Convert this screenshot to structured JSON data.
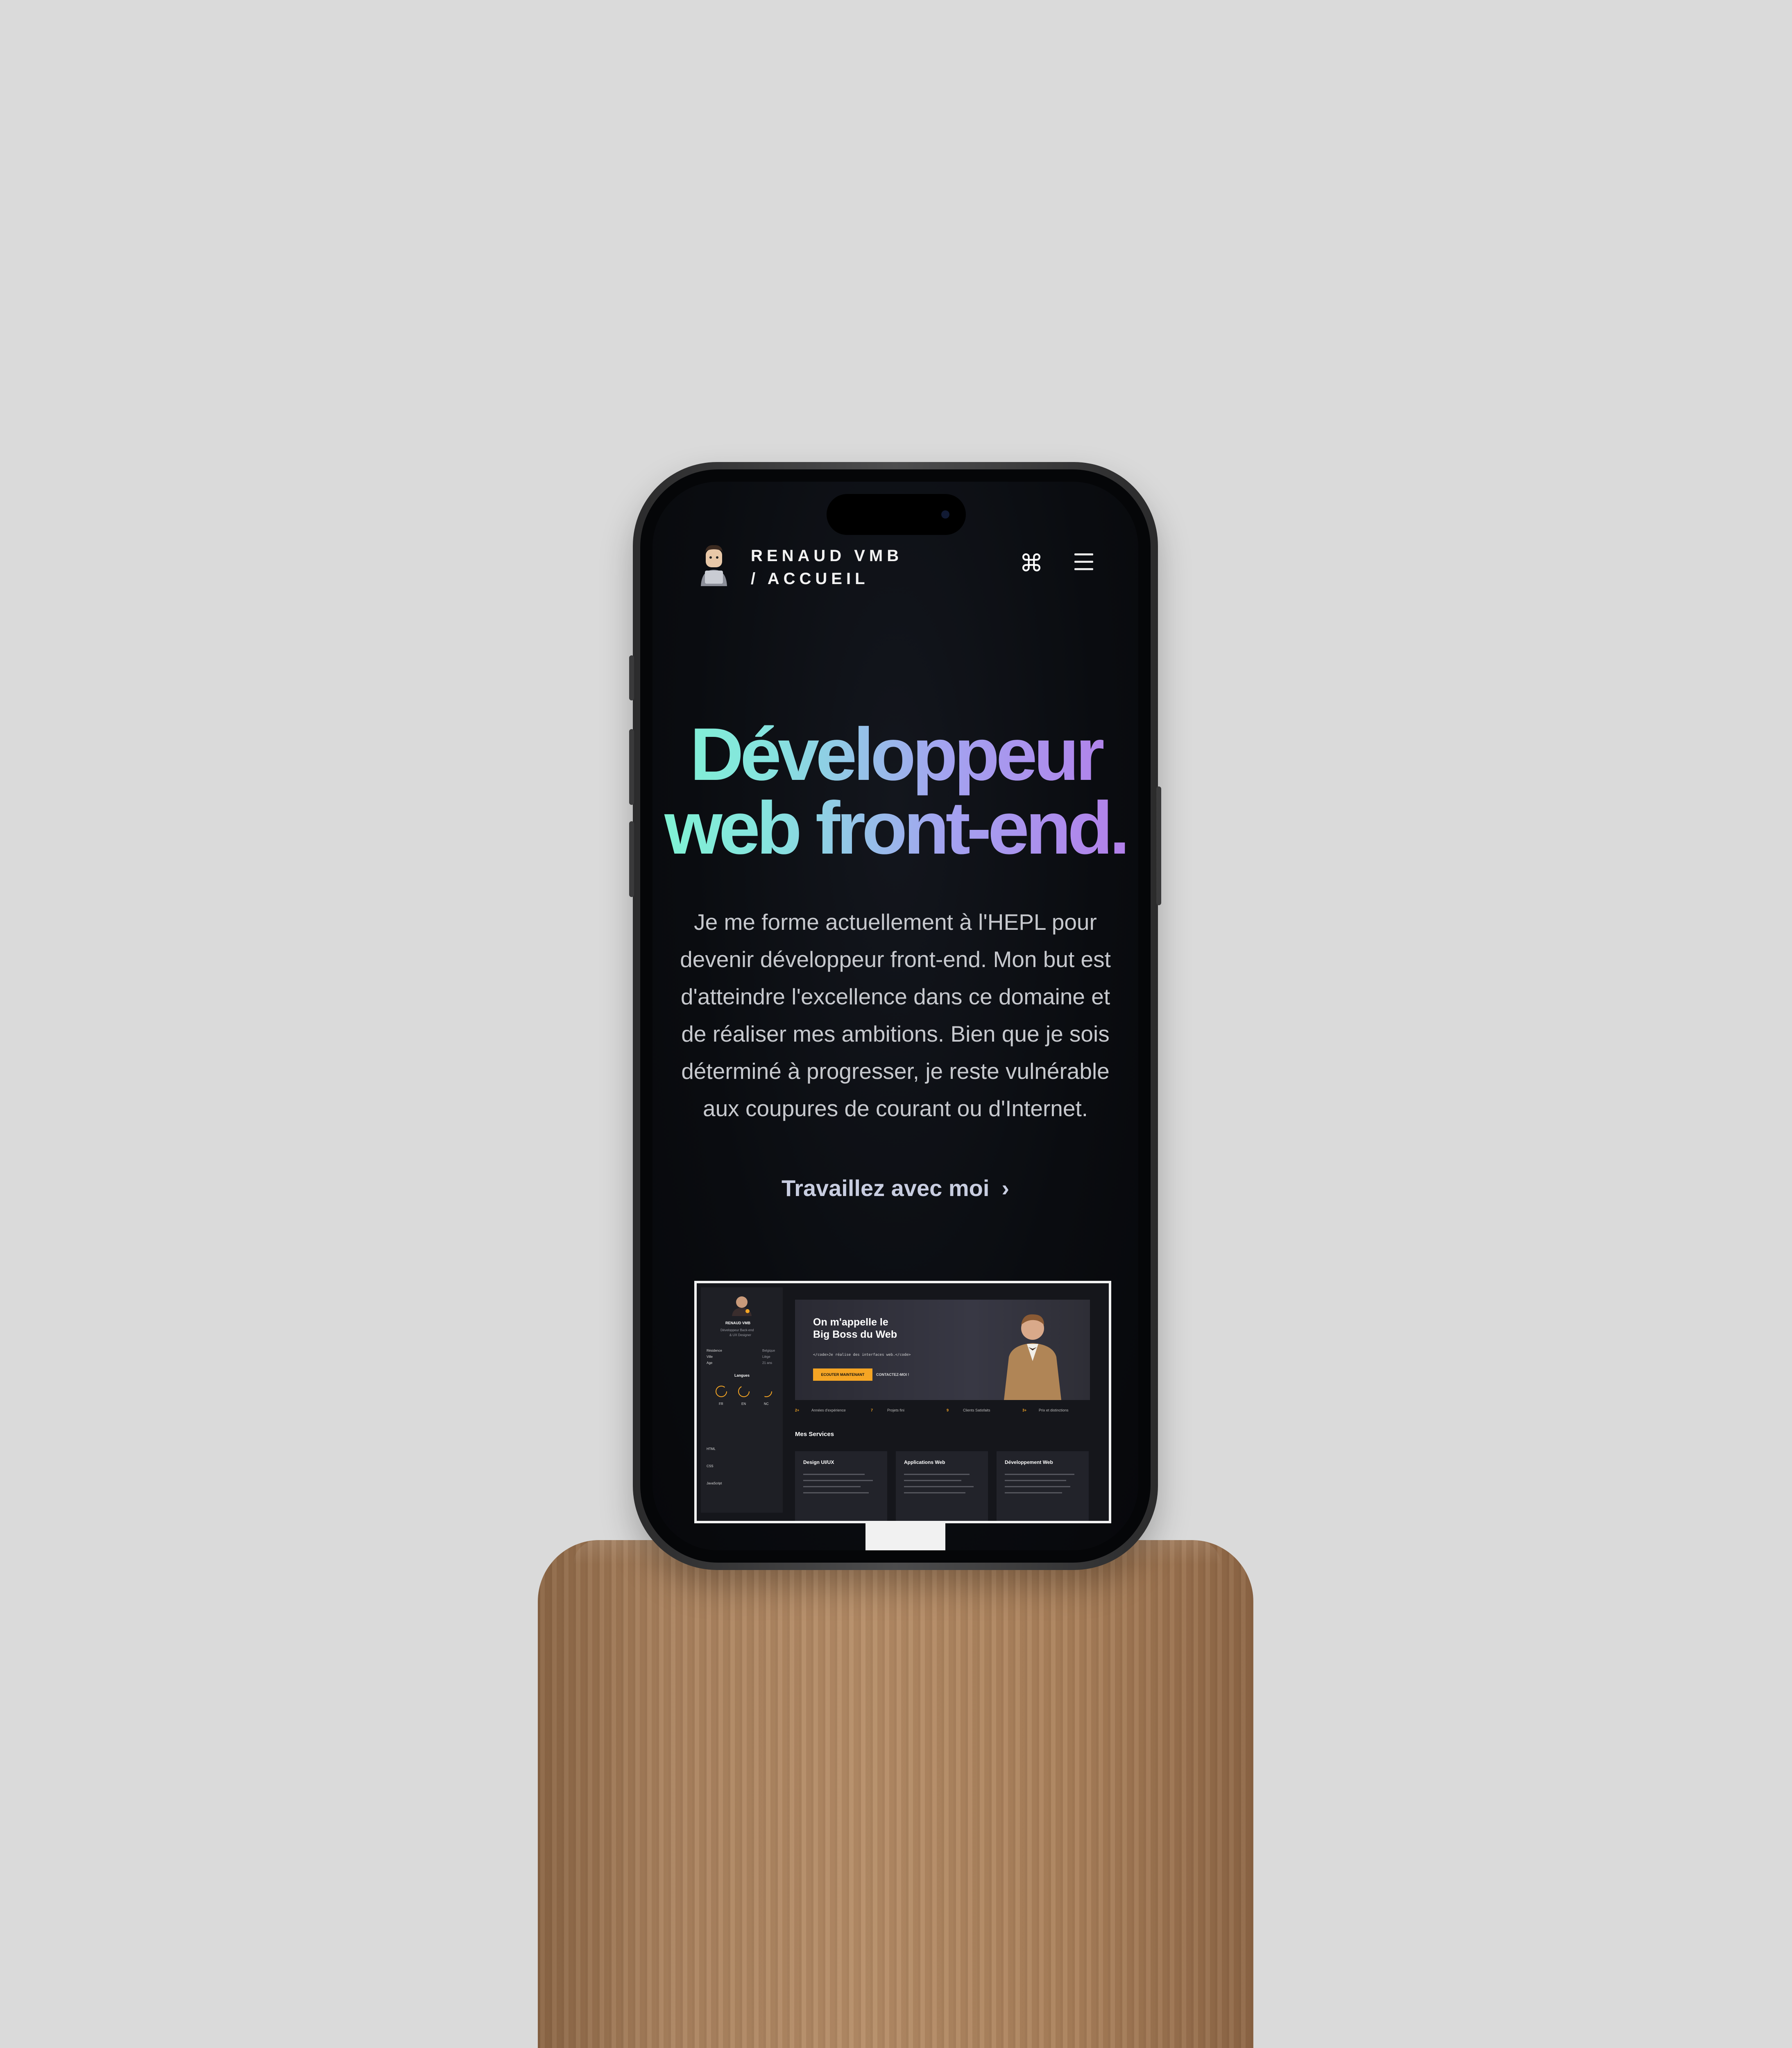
{
  "header": {
    "name_line1": "RENAUD VMB",
    "name_line2": "/ ACCUEIL",
    "command_icon": "⌘",
    "menu_icon": "hamburger-menu"
  },
  "hero": {
    "headline_line1": "Développeur",
    "headline_line2": "web front-end.",
    "gradient_colors": [
      "#7ff4d3",
      "#a3a3f0",
      "#b37de9"
    ],
    "intro_lines": [
      "Je me forme actuellement à l'HEPL pour",
      "devenir développeur front-end. Mon but est",
      "d'atteindre l'excellence dans ce domaine et",
      "de réaliser mes ambitions. Bien que je sois",
      "déterminé à progresser, je reste vulnérable",
      "aux coupures de courant ou d'Internet."
    ],
    "cta_label": "Travaillez avec moi",
    "cta_icon": "chevron-right"
  },
  "preview": {
    "sidebar": {
      "name": "RENAUD VMB",
      "role_line1": "Développeur Back-end",
      "role_line2": "& UX Designer",
      "info": [
        {
          "label": "Résidence",
          "value": "Belgique"
        },
        {
          "label": "Ville",
          "value": "Liège"
        },
        {
          "label": "Age",
          "value": "21 ans"
        }
      ],
      "languages_title": "Langues",
      "languages": [
        "FR",
        "EN",
        "NC"
      ],
      "skills": [
        "HTML",
        "CSS",
        "JavaScript"
      ]
    },
    "hero_title_line1": "On m'appelle le",
    "hero_title_line2": "Big Boss du Web",
    "hero_code": "</code>Je réalise des interfaces web.</code>",
    "button_primary": "ECOUTER MAINTENANT",
    "button_secondary": "CONTACTEZ-MOI !",
    "stats": [
      {
        "value": "2+",
        "label": "Années d'expérience"
      },
      {
        "value": "7",
        "label": "Projets fini"
      },
      {
        "value": "9",
        "label": "Clients Satisfaits"
      },
      {
        "value": "3+",
        "label": "Prix et distinctions"
      }
    ],
    "services_title": "Mes Services",
    "services": [
      "Design UI/UX",
      "Applications Web",
      "Développement Web"
    ],
    "accent_color": "#f5a524"
  }
}
